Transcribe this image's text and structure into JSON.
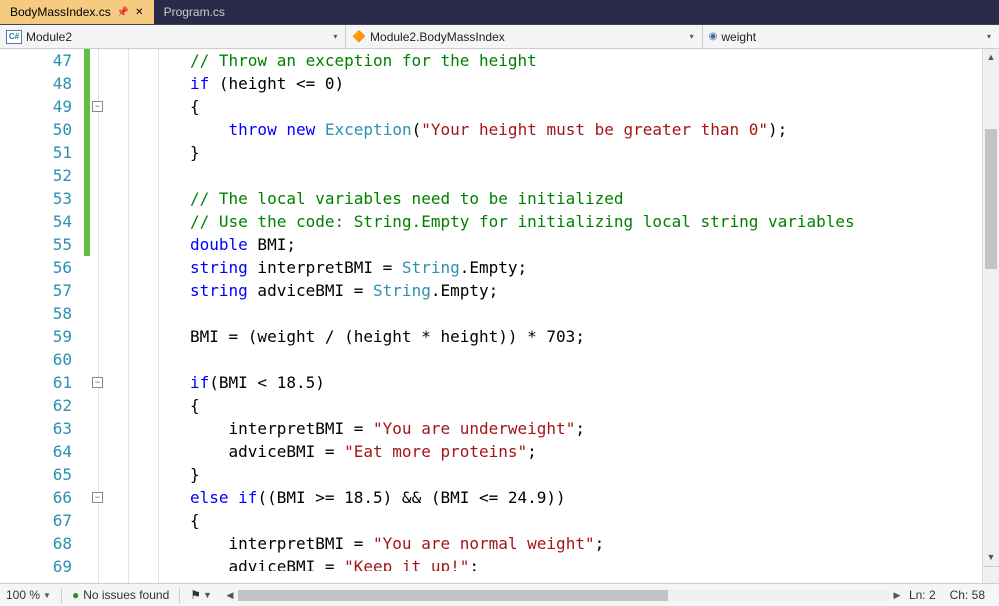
{
  "tabs": {
    "active": "BodyMassIndex.cs",
    "other": "Program.cs"
  },
  "nav": {
    "scope": "Module2",
    "type": "Module2.BodyMassIndex",
    "member": "weight"
  },
  "lines_start": 47,
  "code": [
    {
      "n": 47,
      "indent": 3,
      "tokens": [
        {
          "t": "c",
          "v": "// Throw an exception for the height"
        }
      ]
    },
    {
      "n": 48,
      "indent": 3,
      "tokens": [
        {
          "t": "k",
          "v": "if"
        },
        {
          "t": "n",
          "v": " (height <= 0)"
        }
      ]
    },
    {
      "n": 49,
      "indent": 3,
      "fold": true,
      "tokens": [
        {
          "t": "n",
          "v": "{"
        }
      ]
    },
    {
      "n": 50,
      "indent": 4,
      "tokens": [
        {
          "t": "k",
          "v": "throw"
        },
        {
          "t": "n",
          "v": " "
        },
        {
          "t": "k",
          "v": "new"
        },
        {
          "t": "n",
          "v": " "
        },
        {
          "t": "t",
          "v": "Exception"
        },
        {
          "t": "n",
          "v": "("
        },
        {
          "t": "s",
          "v": "\"Your height must be greater than 0\""
        },
        {
          "t": "n",
          "v": ");"
        }
      ]
    },
    {
      "n": 51,
      "indent": 3,
      "tokens": [
        {
          "t": "n",
          "v": "}"
        }
      ]
    },
    {
      "n": 52,
      "indent": 3,
      "tokens": []
    },
    {
      "n": 53,
      "indent": 3,
      "tokens": [
        {
          "t": "c",
          "v": "// The local variables need to be initialized"
        }
      ]
    },
    {
      "n": 54,
      "indent": 3,
      "tokens": [
        {
          "t": "c",
          "v": "// Use the code: String.Empty for initializing local string variables"
        }
      ]
    },
    {
      "n": 55,
      "indent": 3,
      "trackEnd": true,
      "tokens": [
        {
          "t": "k",
          "v": "double"
        },
        {
          "t": "n",
          "v": " BMI;"
        }
      ]
    },
    {
      "n": 56,
      "indent": 3,
      "tokens": [
        {
          "t": "k",
          "v": "string"
        },
        {
          "t": "n",
          "v": " interpretBMI = "
        },
        {
          "t": "t",
          "v": "String"
        },
        {
          "t": "n",
          "v": ".Empty;"
        }
      ]
    },
    {
      "n": 57,
      "indent": 3,
      "tokens": [
        {
          "t": "k",
          "v": "string"
        },
        {
          "t": "n",
          "v": " adviceBMI = "
        },
        {
          "t": "t",
          "v": "String"
        },
        {
          "t": "n",
          "v": ".Empty;"
        }
      ]
    },
    {
      "n": 58,
      "indent": 3,
      "tokens": []
    },
    {
      "n": 59,
      "indent": 3,
      "tokens": [
        {
          "t": "n",
          "v": "BMI = (weight / (height * height)) * 703;"
        }
      ]
    },
    {
      "n": 60,
      "indent": 3,
      "tokens": []
    },
    {
      "n": 61,
      "indent": 3,
      "fold": true,
      "tokens": [
        {
          "t": "k",
          "v": "if"
        },
        {
          "t": "n",
          "v": "(BMI < 18.5)"
        }
      ]
    },
    {
      "n": 62,
      "indent": 3,
      "tokens": [
        {
          "t": "n",
          "v": "{"
        }
      ]
    },
    {
      "n": 63,
      "indent": 4,
      "tokens": [
        {
          "t": "n",
          "v": "interpretBMI = "
        },
        {
          "t": "s",
          "v": "\"You are underweight\""
        },
        {
          "t": "n",
          "v": ";"
        }
      ]
    },
    {
      "n": 64,
      "indent": 4,
      "tokens": [
        {
          "t": "n",
          "v": "adviceBMI = "
        },
        {
          "t": "s",
          "v": "\"Eat more proteins\""
        },
        {
          "t": "n",
          "v": ";"
        }
      ]
    },
    {
      "n": 65,
      "indent": 3,
      "tokens": [
        {
          "t": "n",
          "v": "}"
        }
      ]
    },
    {
      "n": 66,
      "indent": 3,
      "fold": true,
      "tokens": [
        {
          "t": "k",
          "v": "else"
        },
        {
          "t": "n",
          "v": " "
        },
        {
          "t": "k",
          "v": "if"
        },
        {
          "t": "n",
          "v": "((BMI >= 18.5) && (BMI <= 24.9))"
        }
      ]
    },
    {
      "n": 67,
      "indent": 3,
      "tokens": [
        {
          "t": "n",
          "v": "{"
        }
      ]
    },
    {
      "n": 68,
      "indent": 4,
      "tokens": [
        {
          "t": "n",
          "v": "interpretBMI = "
        },
        {
          "t": "s",
          "v": "\"You are normal weight\""
        },
        {
          "t": "n",
          "v": ";"
        }
      ]
    },
    {
      "n": 69,
      "indent": 4,
      "cut": true,
      "tokens": [
        {
          "t": "n",
          "v": "adviceBMI = "
        },
        {
          "t": "s",
          "v": "\"Keep it up!\""
        },
        {
          "t": "n",
          "v": ";"
        }
      ]
    }
  ],
  "status": {
    "zoom": "100 %",
    "issues": "No issues found",
    "line": "Ln: 2",
    "char": "Ch: 58"
  }
}
